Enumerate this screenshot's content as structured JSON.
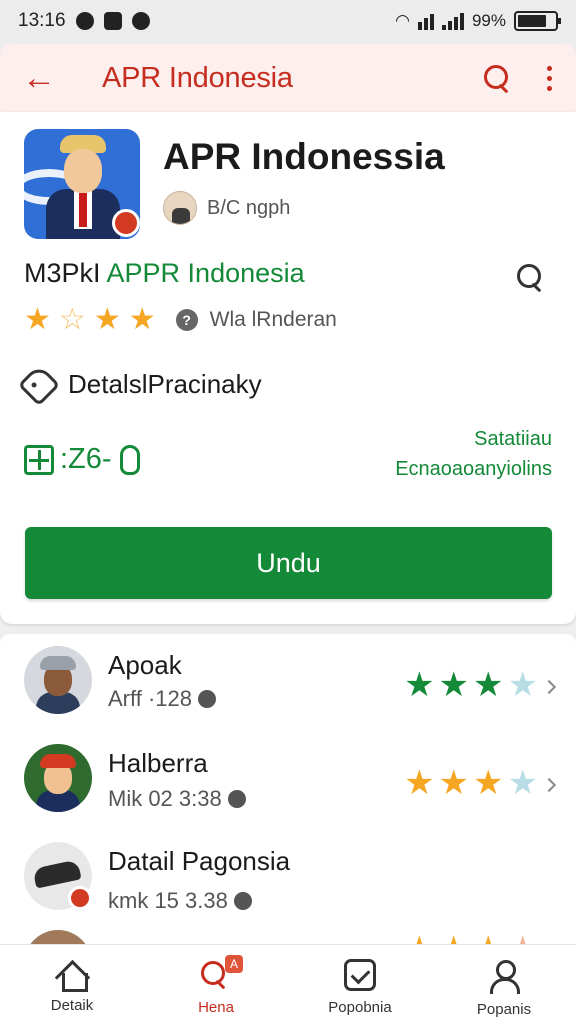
{
  "status_bar": {
    "time": "13:16",
    "battery": "99%"
  },
  "app_bar": {
    "title": "APR Indonesia"
  },
  "app": {
    "name": "APR Indonessia",
    "developer": "B/C ngph",
    "rating_title_prefix": "M3PkI ",
    "rating_title_highlight": "APPR Indonesia",
    "rating": 4,
    "rating_max": 5,
    "review_label": "Wla lRnderan",
    "privacy_label": "DetalslPracinaky",
    "size_label": ":Z6-",
    "side_note_line1": "Satatiiau",
    "side_note_line2": "Ecnaoaoanyiolins",
    "install_label": "Undu",
    "accent_green": "#148a38",
    "accent_red": "#c62d1f"
  },
  "reviews": [
    {
      "name": "Apoak",
      "meta": "Arff ·128",
      "stars": 3.5,
      "star_color": "#148a38"
    },
    {
      "name": "Halberra",
      "meta": "Mik 02 3:38",
      "stars": 3.5,
      "star_color": "#f5a623"
    },
    {
      "name": "Datail Pagonsia",
      "meta": "kmk 15 3.38",
      "stars": null,
      "star_color": "#f5a623"
    }
  ],
  "bottom_nav": {
    "items": [
      {
        "label": "Detaik",
        "icon": "home-icon"
      },
      {
        "label": "Hena",
        "icon": "search-icon",
        "badge": "A"
      },
      {
        "label": "Popobnia",
        "icon": "checkbox-icon"
      },
      {
        "label": "Popanis",
        "icon": "user-icon"
      }
    ]
  }
}
